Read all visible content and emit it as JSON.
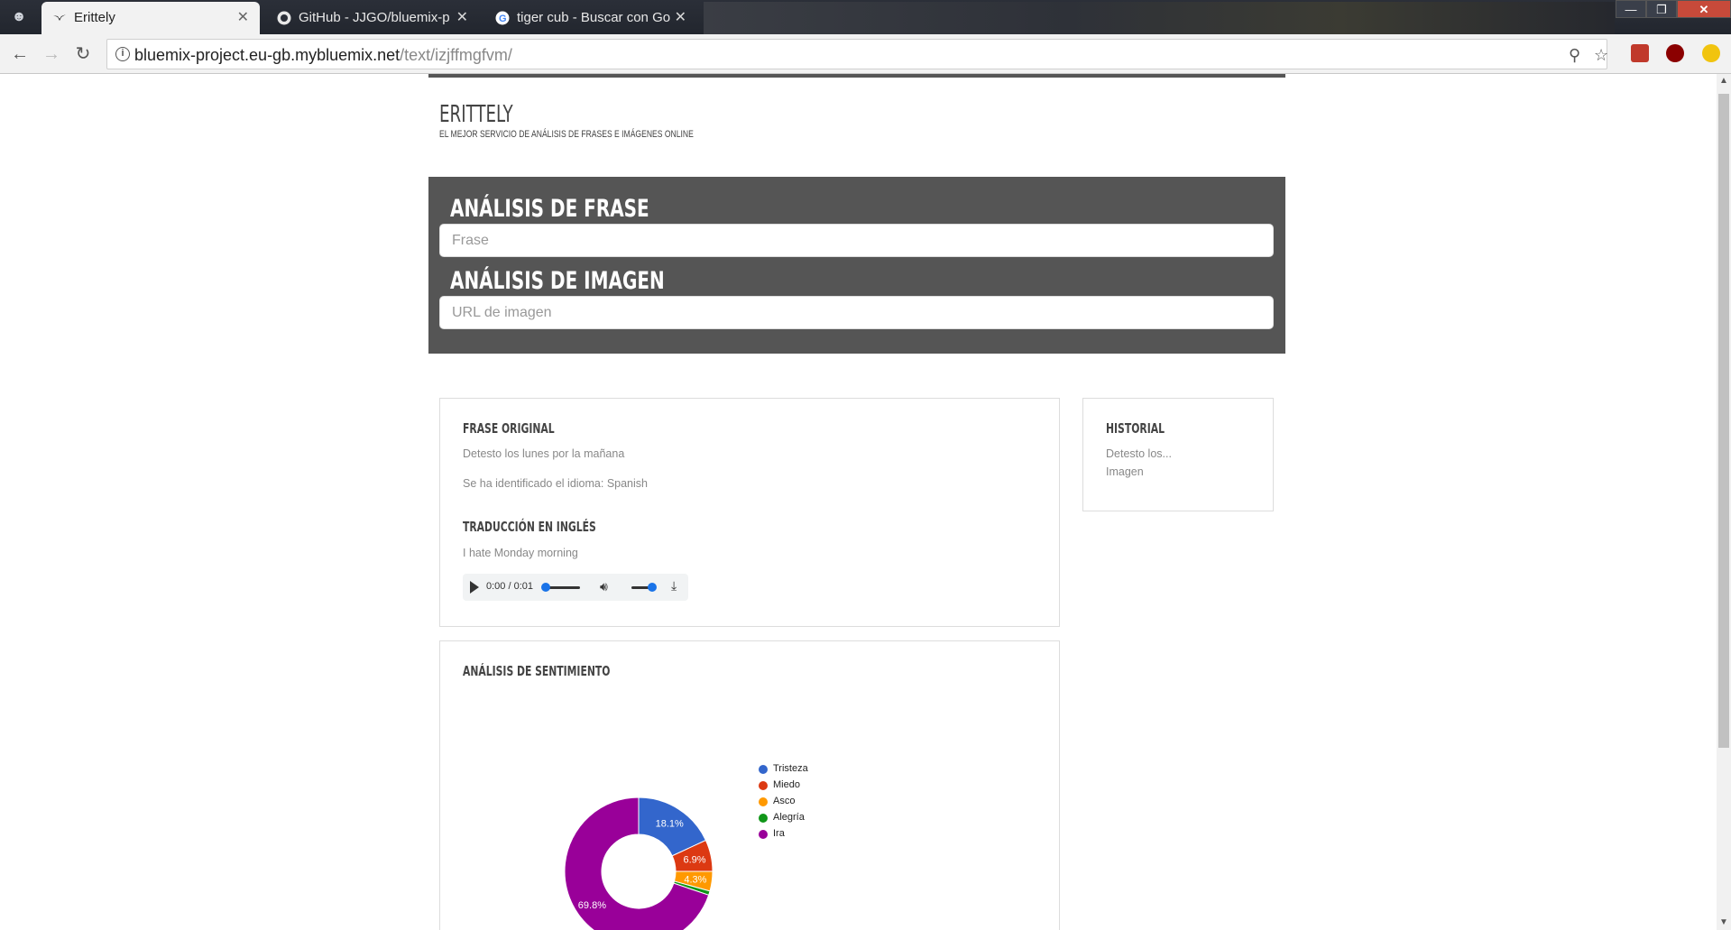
{
  "browser": {
    "tabs": [
      {
        "title": "Erittely",
        "active": true
      },
      {
        "title": "GitHub - JJGO/bluemix-p",
        "active": false
      },
      {
        "title": "tiger cub - Buscar con Go",
        "active": false
      }
    ],
    "url_host": "bluemix-project.eu-gb.mybluemix.net",
    "url_path": "/text/izjffmgfvm/"
  },
  "site": {
    "title": "ERITTELY",
    "tagline": "EL MEJOR SERVICIO DE ANÁLISIS DE FRASES E IMÁGENES ONLINE"
  },
  "search": {
    "phrase_heading": "ANÁLISIS DE FRASE",
    "phrase_placeholder": "Frase",
    "image_heading": "ANÁLISIS DE IMAGEN",
    "image_placeholder": "URL de imagen"
  },
  "result": {
    "original_heading": "FRASE ORIGINAL",
    "original_text": "Detesto los lunes por la mañana",
    "language_text": "Se ha identificado el idioma: Spanish",
    "translation_heading": "TRADUCCIÓN EN INGLÉS",
    "translation_text": "I hate Monday morning",
    "audio_time": "0:00 / 0:01"
  },
  "history": {
    "heading": "HISTORIAL",
    "items": [
      "Detesto los...",
      "Imagen"
    ]
  },
  "sentiment": {
    "heading": "ANÁLISIS DE SENTIMIENTO"
  },
  "chart_data": {
    "type": "pie",
    "donut": true,
    "title": "",
    "legend_position": "right",
    "series": [
      {
        "name": "Tristeza",
        "value": 18.1,
        "color": "#3366cc",
        "label": "18.1%"
      },
      {
        "name": "Miedo",
        "value": 6.9,
        "color": "#dc3912",
        "label": "6.9%"
      },
      {
        "name": "Asco",
        "value": 4.3,
        "color": "#ff9900",
        "label": "4.3%"
      },
      {
        "name": "Alegría",
        "value": 0.9,
        "color": "#109618",
        "label": ""
      },
      {
        "name": "Ira",
        "value": 69.8,
        "color": "#990099",
        "label": "69.8%"
      }
    ]
  }
}
